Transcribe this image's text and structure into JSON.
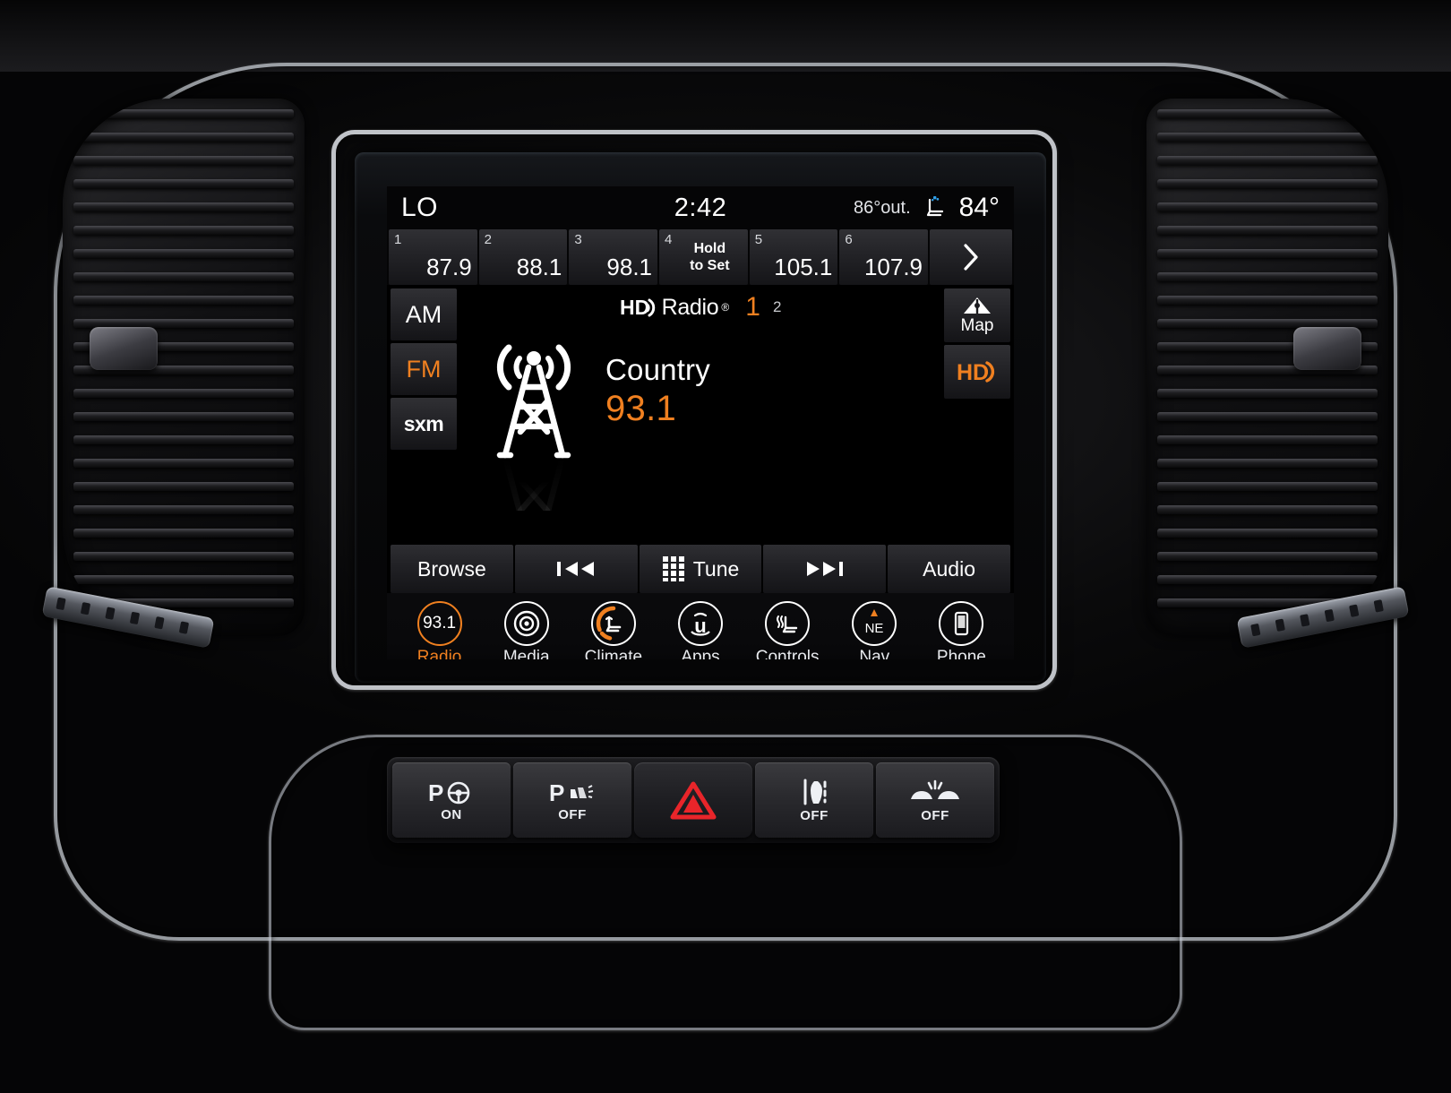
{
  "device": {
    "name": "uconnect-infotainment-touchscreen",
    "accent_color": "#f08020",
    "text_color": "#ffffff",
    "screen_background": "#000000"
  },
  "status_bar": {
    "driver_temp": "LO",
    "time": "2:42",
    "outside_temp": "86°out.",
    "seat_icon": "ventilated-seat-icon",
    "passenger_temp": "84°"
  },
  "presets": {
    "items": [
      {
        "num": "1",
        "value": "87.9",
        "type": "freq"
      },
      {
        "num": "2",
        "value": "88.1",
        "type": "freq"
      },
      {
        "num": "3",
        "value": "98.1",
        "type": "freq"
      },
      {
        "num": "4",
        "value": "Hold\nto Set",
        "line1": "Hold",
        "line2": "to Set",
        "type": "empty"
      },
      {
        "num": "5",
        "value": "105.1",
        "type": "freq"
      },
      {
        "num": "6",
        "value": "107.9",
        "type": "freq"
      }
    ],
    "next_page_icon": "chevron-right-icon"
  },
  "bands": [
    {
      "label": "AM",
      "active": false
    },
    {
      "label": "FM",
      "active": true
    },
    {
      "label": "sxm",
      "active": false
    }
  ],
  "hd_radio": {
    "wordmark": "Radio",
    "registered": "®",
    "channel_active": "1",
    "channel_inactive": "2"
  },
  "station": {
    "genre": "Country",
    "frequency": "93.1",
    "tower_icon": "broadcast-tower-icon"
  },
  "side_buttons": [
    {
      "label": "Map",
      "icon": "map-mountain-icon"
    },
    {
      "label": "",
      "icon": "hd-radio-icon"
    }
  ],
  "control_bar": [
    {
      "label": "Browse",
      "icon": ""
    },
    {
      "label": "",
      "icon": "previous-track-icon"
    },
    {
      "label": "Tune",
      "icon": "keypad-grid-icon"
    },
    {
      "label": "",
      "icon": "next-track-icon"
    },
    {
      "label": "Audio",
      "icon": ""
    }
  ],
  "nav_bar": [
    {
      "label": "Radio",
      "icon": "radio-frequency-icon",
      "badge": "93.1",
      "active": true
    },
    {
      "label": "Media",
      "icon": "disc-icon",
      "active": false
    },
    {
      "label": "Climate",
      "icon": "climate-seat-icon",
      "active": false
    },
    {
      "label": "Apps",
      "icon": "uconnect-u-icon",
      "active": false
    },
    {
      "label": "Controls",
      "icon": "heated-seat-icon",
      "active": false
    },
    {
      "label": "Nav",
      "icon": "compass-ne-icon",
      "badge": "NE",
      "active": false
    },
    {
      "label": "Phone",
      "icon": "smartphone-icon",
      "active": false
    }
  ],
  "physical_buttons": [
    {
      "name": "park-assist-steering",
      "icon": "park-steering-wheel-icon",
      "sub": "ON"
    },
    {
      "name": "park-sensors",
      "icon": "park-sensor-icon",
      "sub": "OFF"
    },
    {
      "name": "hazard-lights",
      "icon": "hazard-triangle-icon",
      "sub": ""
    },
    {
      "name": "lane-departure",
      "icon": "lane-departure-icon",
      "sub": "OFF"
    },
    {
      "name": "collision-warning",
      "icon": "collision-warning-icon",
      "sub": "OFF"
    }
  ]
}
